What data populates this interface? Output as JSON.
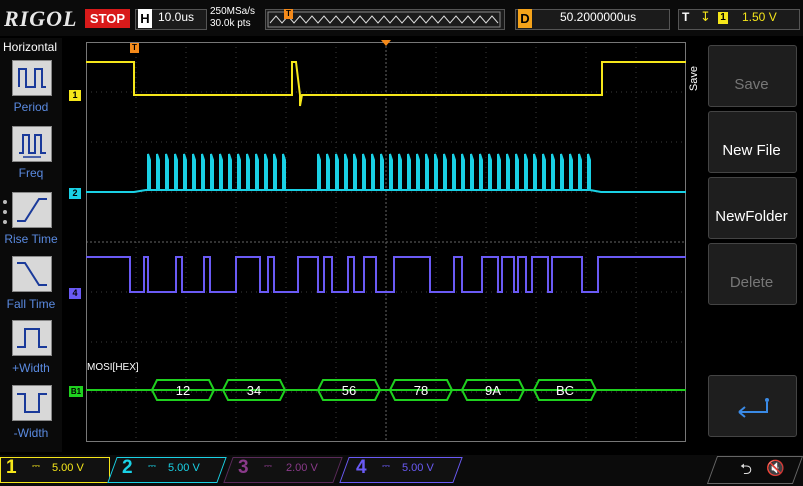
{
  "top": {
    "logo": "RIGOL",
    "run_state": "STOP",
    "timebase_label": "H",
    "timebase_value": "10.0us",
    "sample_rate": "250MSa/s",
    "memory_depth": "30.0k pts",
    "trigger_marker": "T",
    "delay_label": "D",
    "delay_value": "50.2000000us",
    "trigger_label": "T",
    "trigger_source": "1",
    "trigger_level": "1.50 V"
  },
  "left_menu": {
    "title": "Horizontal",
    "items": [
      {
        "label": "Period",
        "icon": "period-icon"
      },
      {
        "label": "Freq",
        "icon": "frequency-icon"
      },
      {
        "label": "Rise Time",
        "icon": "rise-time-icon"
      },
      {
        "label": "Fall Time",
        "icon": "fall-time-icon"
      },
      {
        "label": "+Width",
        "icon": "positive-width-icon"
      },
      {
        "label": "-Width",
        "icon": "negative-width-icon"
      }
    ]
  },
  "right_menu": {
    "tab": "Save",
    "items": [
      {
        "label": "Save",
        "enabled": false
      },
      {
        "label": "New File",
        "enabled": true
      },
      {
        "label": "NewFolder",
        "enabled": true
      },
      {
        "label": "Delete",
        "enabled": false
      },
      {
        "label": "",
        "icon": "return-arrow-icon",
        "enabled": true
      }
    ]
  },
  "channels": {
    "ch1": {
      "number": "1",
      "value": "5.00 V",
      "color": "#f5e61a"
    },
    "ch2": {
      "number": "2",
      "value": "5.00 V",
      "color": "#1ad1e5"
    },
    "ch3": {
      "number": "3",
      "value": "2.00 V",
      "color": "#b23ab2"
    },
    "ch4": {
      "number": "4",
      "value": "5.00 V",
      "color": "#6a5af5"
    }
  },
  "decode": {
    "label": "MOSI[HEX]",
    "bus_marker": "B1",
    "bytes": [
      "12",
      "34",
      "56",
      "78",
      "9A",
      "BC"
    ],
    "color": "#1fd11f"
  },
  "markers": {
    "ch1": "1",
    "ch2": "2",
    "ch4": "4",
    "bus": "B1"
  },
  "status_icons": [
    "usb-icon",
    "speaker-muted-icon"
  ]
}
